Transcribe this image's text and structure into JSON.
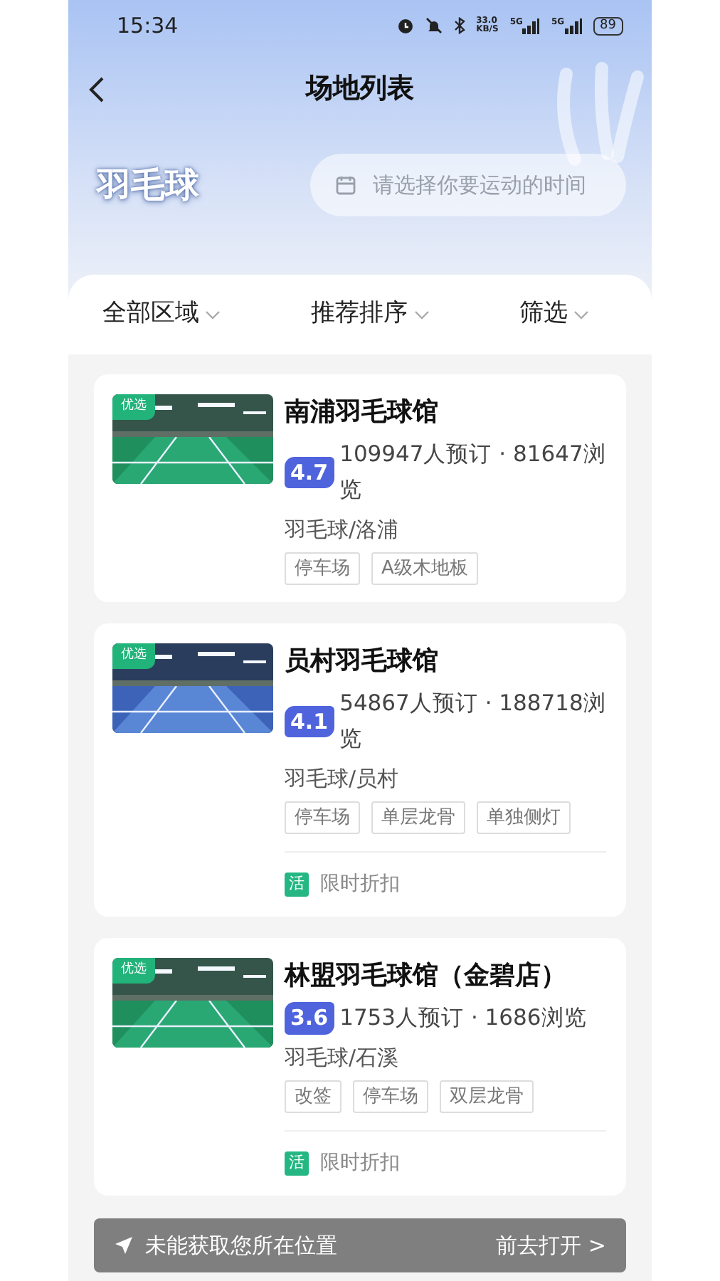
{
  "status_bar": {
    "time": "15:34",
    "speed": "33.0",
    "speed_unit": "KB/S",
    "networks": [
      "5G",
      "5G"
    ],
    "battery": "89"
  },
  "header": {
    "title": "场地列表",
    "sport": "羽毛球",
    "search": {
      "placeholder": "请选择你要运动的时间"
    }
  },
  "filters": [
    {
      "label": "全部区域"
    },
    {
      "label": "推荐排序"
    },
    {
      "label": "筛选"
    }
  ],
  "venues": [
    {
      "badge": "优选",
      "image": {
        "kind": "picture"
      },
      "name": "南浦羽毛球馆",
      "rating": "4.7",
      "stats": "109947人预订 · 81647浏览",
      "category": "羽毛球/洛浦",
      "tags": [
        "停车场",
        "A级木地板"
      ]
    },
    {
      "badge": "优选",
      "image": {
        "kind": "picture"
      },
      "name": "员村羽毛球馆",
      "rating": "4.1",
      "stats": "54867人预订 · 188718浏览",
      "category": "羽毛球/员村",
      "tags": [
        "停车场",
        "单层龙骨",
        "单独侧灯"
      ],
      "promo": {
        "icon": "活",
        "text": "限时折扣"
      }
    },
    {
      "badge": "优选",
      "image": {
        "kind": "picture"
      },
      "name": "林盟羽毛球馆（金碧店）",
      "rating": "3.6",
      "stats": "1753人预订 · 1686浏览",
      "category": "羽毛球/石溪",
      "tags": [
        "改签",
        "停车场",
        "双层龙骨"
      ],
      "promo": {
        "icon": "活",
        "text": "限时折扣"
      }
    }
  ],
  "toast": {
    "message": "未能获取您所在位置",
    "action": "前去打开 >"
  }
}
